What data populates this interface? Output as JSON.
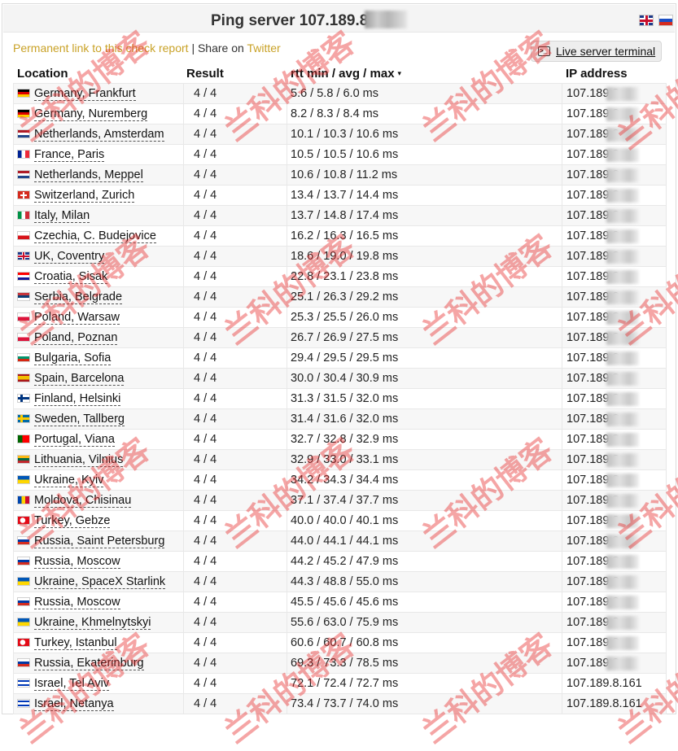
{
  "page": {
    "title_prefix": "Ping server",
    "title_ip_visible": "107.189.8",
    "permalink_label": "Permanent link to this check report",
    "separator": "|",
    "share_label": "Share on",
    "twitter_label": "Twitter",
    "terminal_button": "Live server terminal"
  },
  "languages": [
    {
      "name": "english-flag-icon"
    },
    {
      "name": "russian-flag-icon"
    }
  ],
  "table": {
    "headers": {
      "location": "Location",
      "result": "Result",
      "rtt": "rtt min / avg / max",
      "rtt_sort_glyph": "▾",
      "ip": "IP address"
    },
    "rows": [
      {
        "location": "Germany, Frankfurt",
        "flag": "de",
        "result": "4 / 4",
        "rtt": "5.6 / 5.8 / 6.0 ms",
        "ip": "107.189.8",
        "ip_masked": true
      },
      {
        "location": "Germany, Nuremberg",
        "flag": "de",
        "result": "4 / 4",
        "rtt": "8.2 / 8.3 / 8.4 ms",
        "ip": "107.189.8",
        "ip_masked": true
      },
      {
        "location": "Netherlands, Amsterdam",
        "flag": "nl",
        "result": "4 / 4",
        "rtt": "10.1 / 10.3 / 10.6 ms",
        "ip": "107.189.8",
        "ip_masked": true
      },
      {
        "location": "France, Paris",
        "flag": "fr",
        "result": "4 / 4",
        "rtt": "10.5 / 10.5 / 10.6 ms",
        "ip": "107.189.8",
        "ip_masked": true
      },
      {
        "location": "Netherlands, Meppel",
        "flag": "nl",
        "result": "4 / 4",
        "rtt": "10.6 / 10.8 / 11.2 ms",
        "ip": "107.189.8",
        "ip_masked": true
      },
      {
        "location": "Switzerland, Zurich",
        "flag": "ch",
        "result": "4 / 4",
        "rtt": "13.4 / 13.7 / 14.4 ms",
        "ip": "107.189.8",
        "ip_masked": true
      },
      {
        "location": "Italy, Milan",
        "flag": "it",
        "result": "4 / 4",
        "rtt": "13.7 / 14.8 / 17.4 ms",
        "ip": "107.189.8",
        "ip_masked": true
      },
      {
        "location": "Czechia, C. Budejovice",
        "flag": "cz",
        "result": "4 / 4",
        "rtt": "16.2 / 16.3 / 16.5 ms",
        "ip": "107.189.8",
        "ip_masked": true
      },
      {
        "location": "UK, Coventry",
        "flag": "uk",
        "result": "4 / 4",
        "rtt": "18.6 / 19.0 / 19.8 ms",
        "ip": "107.189.8",
        "ip_masked": true
      },
      {
        "location": "Croatia, Sisak",
        "flag": "hr",
        "result": "4 / 4",
        "rtt": "22.8 / 23.1 / 23.8 ms",
        "ip": "107.189.8",
        "ip_masked": true
      },
      {
        "location": "Serbia, Belgrade",
        "flag": "rs",
        "result": "4 / 4",
        "rtt": "25.1 / 26.3 / 29.2 ms",
        "ip": "107.189.8",
        "ip_masked": true
      },
      {
        "location": "Poland, Warsaw",
        "flag": "pl",
        "result": "4 / 4",
        "rtt": "25.3 / 25.5 / 26.0 ms",
        "ip": "107.189.8",
        "ip_masked": true
      },
      {
        "location": "Poland, Poznan",
        "flag": "pl",
        "result": "4 / 4",
        "rtt": "26.7 / 26.9 / 27.5 ms",
        "ip": "107.189.8",
        "ip_masked": true
      },
      {
        "location": "Bulgaria, Sofia",
        "flag": "bg",
        "result": "4 / 4",
        "rtt": "29.4 / 29.5 / 29.5 ms",
        "ip": "107.189.8",
        "ip_masked": true
      },
      {
        "location": "Spain, Barcelona",
        "flag": "es",
        "result": "4 / 4",
        "rtt": "30.0 / 30.4 / 30.9 ms",
        "ip": "107.189.8",
        "ip_masked": true
      },
      {
        "location": "Finland, Helsinki",
        "flag": "fi",
        "result": "4 / 4",
        "rtt": "31.3 / 31.5 / 32.0 ms",
        "ip": "107.189.8",
        "ip_masked": true
      },
      {
        "location": "Sweden, Tallberg",
        "flag": "se",
        "result": "4 / 4",
        "rtt": "31.4 / 31.6 / 32.0 ms",
        "ip": "107.189.8",
        "ip_masked": true
      },
      {
        "location": "Portugal, Viana",
        "flag": "pt",
        "result": "4 / 4",
        "rtt": "32.7 / 32.8 / 32.9 ms",
        "ip": "107.189.8",
        "ip_masked": true
      },
      {
        "location": "Lithuania, Vilnius",
        "flag": "lt",
        "result": "4 / 4",
        "rtt": "32.9 / 33.0 / 33.1 ms",
        "ip": "107.189.8",
        "ip_masked": true
      },
      {
        "location": "Ukraine, Kyiv",
        "flag": "ua",
        "result": "4 / 4",
        "rtt": "34.2 / 34.3 / 34.4 ms",
        "ip": "107.189.8",
        "ip_masked": true
      },
      {
        "location": "Moldova, Chisinau",
        "flag": "md",
        "result": "4 / 4",
        "rtt": "37.1 / 37.4 / 37.7 ms",
        "ip": "107.189.8",
        "ip_masked": true
      },
      {
        "location": "Turkey, Gebze",
        "flag": "tr",
        "result": "4 / 4",
        "rtt": "40.0 / 40.0 / 40.1 ms",
        "ip": "107.189.8",
        "ip_masked": true
      },
      {
        "location": "Russia, Saint Petersburg",
        "flag": "ru",
        "result": "4 / 4",
        "rtt": "44.0 / 44.1 / 44.1 ms",
        "ip": "107.189.8",
        "ip_masked": true
      },
      {
        "location": "Russia, Moscow",
        "flag": "ru",
        "result": "4 / 4",
        "rtt": "44.2 / 45.2 / 47.9 ms",
        "ip": "107.189.8",
        "ip_masked": true
      },
      {
        "location": "Ukraine, SpaceX Starlink",
        "flag": "ua",
        "result": "4 / 4",
        "rtt": "44.3 / 48.8 / 55.0 ms",
        "ip": "107.189.8",
        "ip_masked": true
      },
      {
        "location": "Russia, Moscow",
        "flag": "ru",
        "result": "4 / 4",
        "rtt": "45.5 / 45.6 / 45.6 ms",
        "ip": "107.189.8",
        "ip_masked": true
      },
      {
        "location": "Ukraine, Khmelnytskyi",
        "flag": "ua",
        "result": "4 / 4",
        "rtt": "55.6 / 63.0 / 75.9 ms",
        "ip": "107.189.8",
        "ip_masked": true
      },
      {
        "location": "Turkey, Istanbul",
        "flag": "tr",
        "result": "4 / 4",
        "rtt": "60.6 / 60.7 / 60.8 ms",
        "ip": "107.189.8",
        "ip_masked": true
      },
      {
        "location": "Russia, Ekaterinburg",
        "flag": "ru",
        "result": "4 / 4",
        "rtt": "69.3 / 73.3 / 78.5 ms",
        "ip": "107.189.8",
        "ip_masked": true
      },
      {
        "location": "Israel, Tel Aviv",
        "flag": "il",
        "result": "4 / 4",
        "rtt": "72.1 / 72.4 / 72.7 ms",
        "ip": "107.189.8.161",
        "ip_masked": false
      },
      {
        "location": "Israel, Netanya",
        "flag": "il",
        "result": "4 / 4",
        "rtt": "73.4 / 73.7 / 74.0 ms",
        "ip": "107.189.8.161",
        "ip_masked": false
      }
    ]
  },
  "watermark": {
    "text": "兰科的博客",
    "color": "#e62828"
  },
  "flags": {
    "de": "linear-gradient(#000 0 33%, #dd0000 33% 66%, #ffce00 66% 100%)",
    "nl": "linear-gradient(#ae1c28 0 33%, #ffffff 33% 66%, #21468b 66% 100%)",
    "fr": "linear-gradient(90deg, #002395 0 33%, #ffffff 33% 66%, #ed2939 66% 100%)",
    "ch": "linear-gradient(#fff,#fff) center/8px 2px no-repeat, linear-gradient(#fff,#fff) center/2px 8px no-repeat, #d52b1e",
    "it": "linear-gradient(90deg, #009246 0 33%, #ffffff 33% 66%, #ce2b37 66% 100%)",
    "cz": "linear-gradient(#ffffff 0 50%, #d7141a 50% 100%)",
    "uk": "linear-gradient(#c8102e,#c8102e) center/100% 2px no-repeat, linear-gradient(90deg,#c8102e,#c8102e) center/2px 100% no-repeat, linear-gradient(#fff,#fff) center/100% 4px no-repeat, linear-gradient(90deg,#fff,#fff) center/4px 100% no-repeat, #1e3a8a",
    "hr": "linear-gradient(#ff0000 0 33%, #ffffff 33% 66%, #171796 66% 100%)",
    "rs": "linear-gradient(#c6363c 0 33%, #0c4076 33% 66%, #ffffff 66% 100%)",
    "pl": "linear-gradient(#ffffff 0 50%, #dc143c 50% 100%)",
    "bg": "linear-gradient(#ffffff 0 33%, #00966e 33% 66%, #d62612 66% 100%)",
    "es": "linear-gradient(#aa151b 0 25%, #f1bf00 25% 75%, #aa151b 75% 100%)",
    "fi": "linear-gradient(#003580,#003580) 0 45%/100% 3px no-repeat, linear-gradient(90deg,#003580,#003580) 30% 0/3px 100% no-repeat, #ffffff",
    "se": "linear-gradient(#fecc00,#fecc00) 0 45%/100% 3px no-repeat, linear-gradient(90deg,#fecc00,#fecc00) 30% 0/3px 100% no-repeat, #006aa7",
    "pt": "linear-gradient(90deg, #006600 0 40%, #ff0000 40% 100%)",
    "lt": "linear-gradient(#fdb913 0 33%, #006a44 33% 66%, #c1272d 66% 100%)",
    "ua": "linear-gradient(#0057b7 0 50%, #ffd700 50% 100%)",
    "md": "linear-gradient(90deg, #0046ae 0 33%, #ffd200 33% 66%, #cc092f 66% 100%)",
    "tr": "radial-gradient(circle at 42% 50%, #fff 0 3px, transparent 3.5px), #e30a17",
    "ru": "linear-gradient(#ffffff 0 33%, #0039a6 33% 66%, #d52b1e 66% 100%)",
    "il": "linear-gradient(#0038b8,#0038b8) 0 15%/100% 2px no-repeat, linear-gradient(#0038b8,#0038b8) 0 85%/100% 2px no-repeat, #ffffff"
  }
}
